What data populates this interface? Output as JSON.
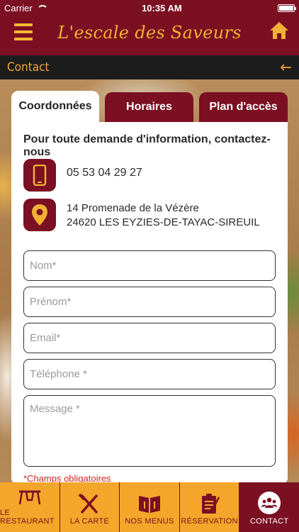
{
  "status_bar": {
    "carrier": "Carrier",
    "time": "10:35 AM"
  },
  "header": {
    "brand": "L'escale des Saveurs",
    "menu_icon": "hamburger-menu-icon",
    "home_icon": "home-icon"
  },
  "subbar": {
    "title": "Contact",
    "back_icon": "arrow-left-icon"
  },
  "tabs": [
    {
      "label": "Coordonnées",
      "active": true
    },
    {
      "label": "Horaires",
      "active": false
    },
    {
      "label": "Plan d'accès",
      "active": false
    }
  ],
  "contact": {
    "intro": "Pour toute demande d'information, contactez-nous",
    "phone": "05 53 04 29 27",
    "address_line1": "14 Promenade de la Vézère",
    "address_line2": "24620 LES EYZIES-DE-TAYAC-SIREUIL"
  },
  "form": {
    "nom_placeholder": "Nom*",
    "prenom_placeholder": "Prénom*",
    "email_placeholder": "Email*",
    "telephone_placeholder": "Téléphone *",
    "message_placeholder": "Message *",
    "required_note": "*Champs obligatoires"
  },
  "bottom_nav": [
    {
      "label": "LE RESTAURANT",
      "icon": "restaurant-icon",
      "active": false
    },
    {
      "label": "LA CARTE",
      "icon": "cutlery-icon",
      "active": false
    },
    {
      "label": "NOS MENUS",
      "icon": "menu-book-icon",
      "active": false
    },
    {
      "label": "RÉSERVATION",
      "icon": "clipboard-icon",
      "active": false
    },
    {
      "label": "CONTACT",
      "icon": "contact-group-icon",
      "active": true
    }
  ],
  "colors": {
    "brand": "#7a1022",
    "accent": "#f4a62a",
    "gold": "#f2b034"
  }
}
